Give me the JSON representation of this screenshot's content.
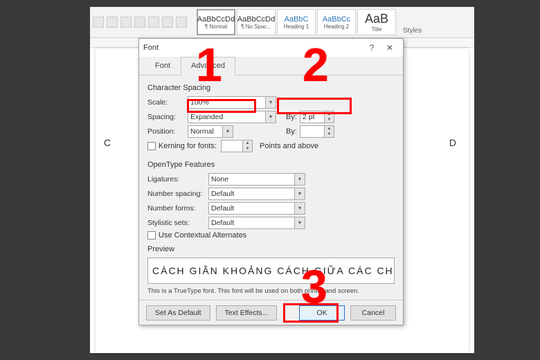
{
  "ribbon": {
    "styles": [
      {
        "sample": "AaBbCcDd",
        "name": "¶ Normal"
      },
      {
        "sample": "AaBbCcDd",
        "name": "¶ No Spac..."
      },
      {
        "sample": "AaBbC",
        "name": "Heading 1"
      },
      {
        "sample": "AaBbCc",
        "name": "Heading 2"
      },
      {
        "sample": "AaB",
        "name": "Title"
      }
    ],
    "group_label": "Styles"
  },
  "page": {
    "left_char": "C",
    "right_char": "D"
  },
  "dialog": {
    "title": "Font",
    "tabs": {
      "font": "Font",
      "advanced": "Advanced"
    },
    "char_spacing": {
      "group": "Character Spacing",
      "scale_lbl": "Scale:",
      "scale_val": "100%",
      "spacing_lbl": "Spacing:",
      "spacing_val": "Expanded",
      "by_lbl": "By:",
      "by_val": "2 pt",
      "position_lbl": "Position:",
      "position_val": "Normal",
      "by2_lbl": "By:",
      "by2_val": "",
      "kerning_lbl": "Kerning for fonts:",
      "kerning_val": "",
      "points_above": "Points and above"
    },
    "opentype": {
      "group": "OpenType Features",
      "ligatures_lbl": "Ligatures:",
      "ligatures_val": "None",
      "numspacing_lbl": "Number spacing:",
      "numspacing_val": "Default",
      "numforms_lbl": "Number forms:",
      "numforms_val": "Default",
      "styleset_lbl": "Stylistic sets:",
      "styleset_val": "Default",
      "contextual_lbl": "Use Contextual Alternates"
    },
    "preview": {
      "group": "Preview",
      "sample": "CÁCH GIÃN KHOẢNG CÁCH GIỮA CÁC CHỮ",
      "note": "This is a TrueType font. This font will be used on both printer and screen."
    },
    "buttons": {
      "default": "Set As Default",
      "effects": "Text Effects...",
      "ok": "OK",
      "cancel": "Cancel"
    }
  },
  "anno": {
    "n1": "1",
    "n2": "2",
    "n3": "3"
  }
}
